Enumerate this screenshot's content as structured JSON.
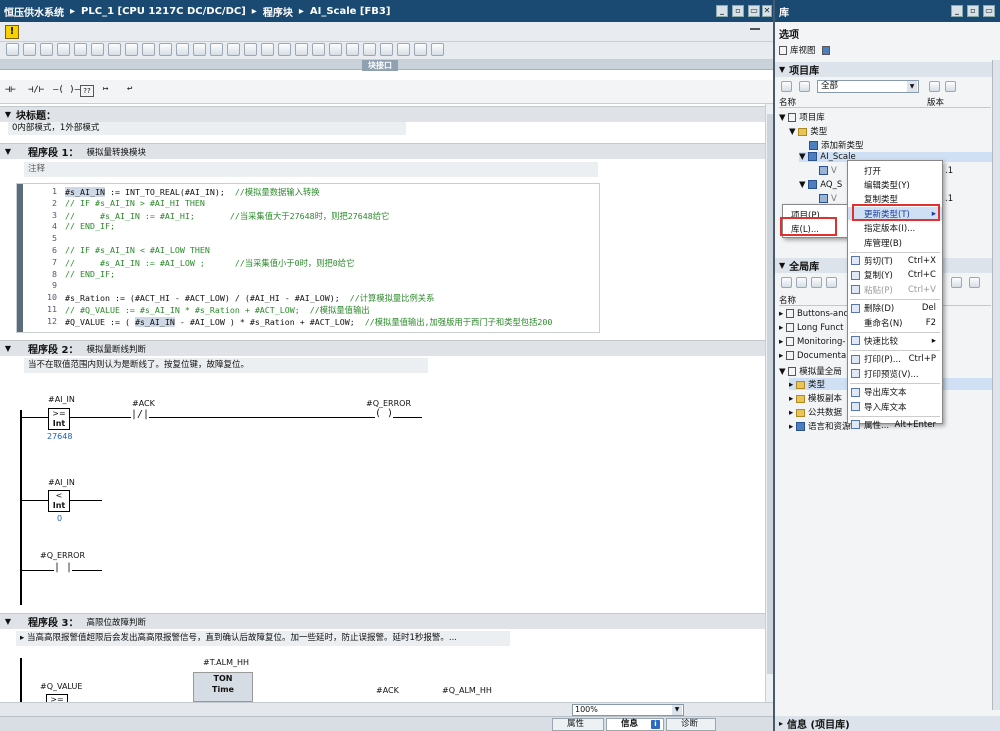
{
  "title": {
    "project": "恒压供水系统",
    "sep1": "▸",
    "device": "PLC_1 [CPU 1217C DC/DC/DC]",
    "sep2": "▸",
    "folder": "程序块",
    "sep3": "▸",
    "block": "AI_Scale [FB3]"
  },
  "window_controls": [
    "_",
    "▫",
    "▭",
    "✕"
  ],
  "right_title": "库",
  "block_interface_label": "块接口",
  "block_title": {
    "label": "块标题：",
    "comment": "0内部模式，1外部模式"
  },
  "segment1": {
    "label": "程序段 1：",
    "title": "模拟量转换模块",
    "comment": "注释",
    "lines": [
      {
        "n": "1",
        "parts": [
          {
            "t": "#s_AI_IN",
            "hl": true
          },
          {
            "t": " := INT_TO_REAL(#AI_IN);  "
          },
          {
            "t": "//模拟量数据输入转换",
            "c": true
          }
        ]
      },
      {
        "n": "2",
        "parts": [
          {
            "t": "// IF #s_AI_IN > #AI_HI THEN",
            "c": true
          }
        ]
      },
      {
        "n": "3",
        "parts": [
          {
            "t": "//     #s_AI_IN := #AI_HI;       //当采集值大于27648时，则把27648给它",
            "c": true
          }
        ]
      },
      {
        "n": "4",
        "parts": [
          {
            "t": "// END_IF;",
            "c": true
          }
        ]
      },
      {
        "n": "5",
        "parts": [
          {
            "t": ""
          }
        ]
      },
      {
        "n": "6",
        "parts": [
          {
            "t": "// IF #s_AI_IN < #AI_LOW THEN",
            "c": true
          }
        ]
      },
      {
        "n": "7",
        "parts": [
          {
            "t": "//     #s_AI_IN := #AI_LOW ;      //当采集值小于0时，则把0给它",
            "c": true
          }
        ]
      },
      {
        "n": "8",
        "parts": [
          {
            "t": "// END_IF;",
            "c": true
          }
        ]
      },
      {
        "n": "9",
        "parts": [
          {
            "t": ""
          }
        ]
      },
      {
        "n": "10",
        "parts": [
          {
            "t": "#s_Ration := (#ACT_HI - #ACT_LOW) / (#AI_HI - #AI_LOW);  "
          },
          {
            "t": "//计算模拟量比例关系",
            "c": true
          }
        ]
      },
      {
        "n": "11",
        "parts": [
          {
            "t": "// #Q_VALUE := #s_AI_IN * #s_Ration + #ACT_LOW;  //模拟量值输出",
            "c": true
          }
        ]
      },
      {
        "n": "12",
        "parts": [
          {
            "t": "#Q_VALUE := ( "
          },
          {
            "t": "#s_AI_IN",
            "hl": true
          },
          {
            "t": " - #AI_LOW ) * #s_Ration + #ACT_LOW;  "
          },
          {
            "t": "//模拟量值输出,加强版用于西门子和类型包括200",
            "c": true
          }
        ]
      }
    ]
  },
  "segment2": {
    "label": "程序段 2：",
    "title": "模拟量断线判断",
    "comment": "当不在取值范围内则认为是断线了。按复位键，故障复位。",
    "ai_in_1": "#AI_IN",
    "op_ge": ">=",
    "type_int_1": "Int",
    "val_27648": "27648",
    "ack": "#ACK",
    "q_error": "#Q_ERROR",
    "ai_in_2": "#AI_IN",
    "op_lt": "<",
    "type_int_2": "Int",
    "val_0": "0",
    "q_error_2": "#Q_ERROR"
  },
  "segment3": {
    "label": "程序段 3：",
    "title": "高限位故障判断",
    "comment": "当高高限报警值超限后会发出高高限报警信号，直到确认后故障复位。加一些延时，防止误报警。延时1秒报警。...",
    "timer": "#T.ALM_HH",
    "ton": "TON",
    "time": "Time",
    "q_value": "#Q_VALUE",
    "op_ge": ">=",
    "ack": "#ACK",
    "q_alm_hh": "#Q_ALM_HH"
  },
  "zoom": {
    "value": "100%"
  },
  "bottom_tabs": [
    {
      "label": "属性"
    },
    {
      "label": "信息"
    },
    {
      "label": "诊断"
    }
  ],
  "library": {
    "options_label": "选项",
    "lib_view_label": "库视图",
    "project_lib_label": "项目库",
    "filter_value": "全部",
    "col_name": "名称",
    "col_version": "版本",
    "tree": [
      {
        "label": "项目库"
      },
      {
        "label": "类型"
      },
      {
        "label": "添加新类型"
      },
      {
        "label": "AI_Scale"
      },
      {
        "label": "V"
      },
      {
        "label": "AQ_S"
      },
      {
        "label": "V"
      }
    ],
    "version_1": ".1",
    "version_2": ".1",
    "global_lib_label": "全局库",
    "global_col_name": "名称",
    "global_tree": [
      {
        "label": "Buttons-and"
      },
      {
        "label": "Long Funct"
      },
      {
        "label": "Monitoring-"
      },
      {
        "label": "Documenta"
      },
      {
        "label": "模拟量全局"
      },
      {
        "label": "类型"
      },
      {
        "label": "模板副本"
      },
      {
        "label": "公共数据"
      },
      {
        "label": "语言和资源"
      }
    ],
    "info_label": "信息 (项目库)"
  },
  "submenu": {
    "items": [
      "项目(P)...",
      "库(L)..."
    ]
  },
  "context_menu": {
    "items": [
      {
        "label": "打开",
        "shortcut": ""
      },
      {
        "label": "编辑类型(Y)",
        "shortcut": ""
      },
      {
        "label": "复制类型",
        "shortcut": ""
      },
      {
        "label": "更新类型(T)",
        "shortcut": "▸"
      },
      {
        "label": "指定版本(I)...",
        "shortcut": ""
      },
      {
        "label": "库管理(B)",
        "shortcut": ""
      },
      {
        "label": "剪切(T)",
        "shortcut": "Ctrl+X"
      },
      {
        "label": "复制(Y)",
        "shortcut": "Ctrl+C"
      },
      {
        "label": "粘贴(P)",
        "shortcut": "Ctrl+V"
      },
      {
        "label": "删除(D)",
        "shortcut": "Del"
      },
      {
        "label": "重命名(N)",
        "shortcut": "F2"
      },
      {
        "label": "快速比较",
        "shortcut": "▸"
      },
      {
        "label": "打印(P)...",
        "shortcut": "Ctrl+P"
      },
      {
        "label": "打印预览(V)...",
        "shortcut": ""
      },
      {
        "label": "导出库文本",
        "shortcut": ""
      },
      {
        "label": "导入库文本",
        "shortcut": ""
      },
      {
        "label": "属性...",
        "shortcut": "Alt+Enter"
      }
    ]
  },
  "colors": {
    "titlebar": "#1a4a72",
    "highlight_red": "#e03030",
    "menu_selected": "#cfe0f4"
  }
}
